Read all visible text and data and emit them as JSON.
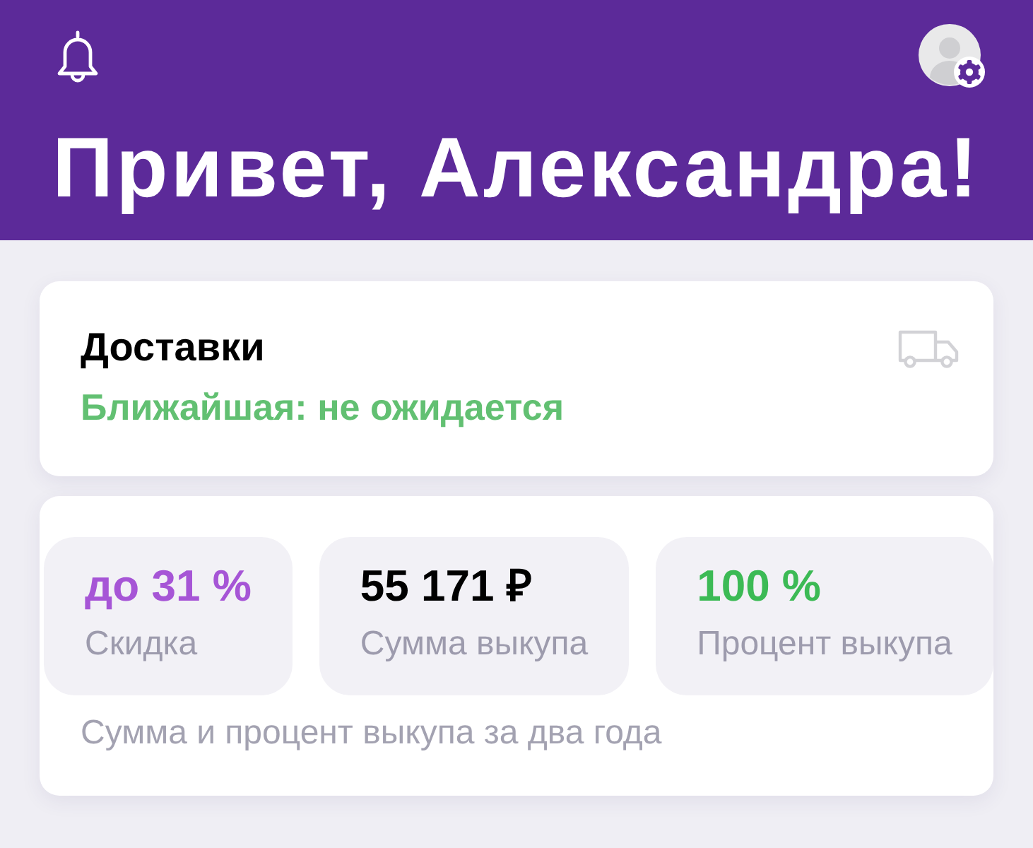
{
  "header": {
    "title": "Привет, Александра!"
  },
  "deliveries": {
    "title": "Доставки",
    "status": "Ближайшая: не ожидается"
  },
  "stats": {
    "items": [
      {
        "value": "до 31 %",
        "label": "Скидка",
        "color": "#a655d6"
      },
      {
        "value": "55 171 ₽",
        "label": "Сумма выкупа",
        "color": "#000000"
      },
      {
        "value": "100 %",
        "label": "Процент выкупа",
        "color": "#3cba55"
      }
    ],
    "caption": "Сумма и процент выкупа за два года"
  }
}
